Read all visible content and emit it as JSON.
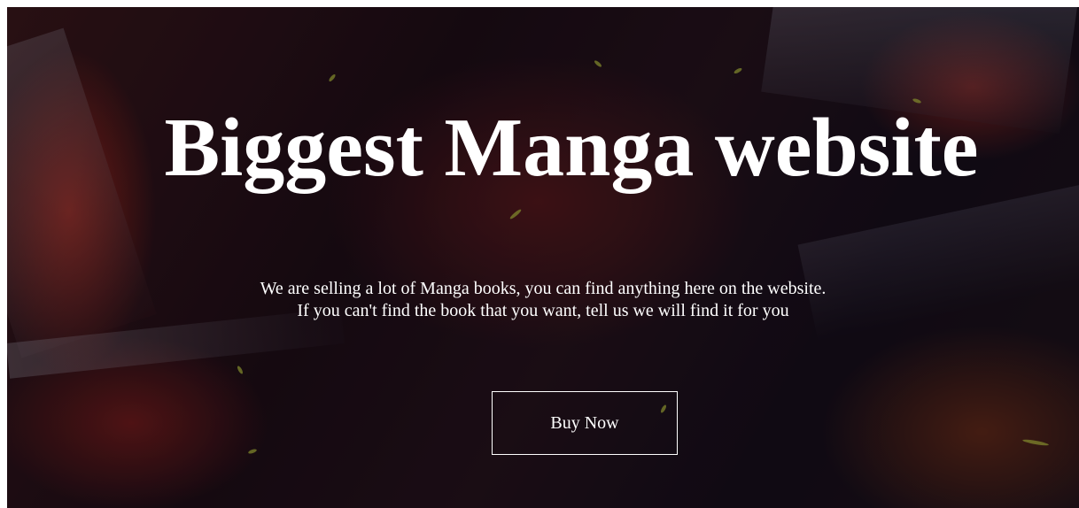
{
  "hero": {
    "headline": "Biggest Manga website",
    "description_line1": "We are selling a lot of Manga books, you can find anything here on the website.",
    "description_line2": "If you can't find the book that you want, tell us we will find it for you",
    "button_label": "Buy Now",
    "background_image": "manga-artwork-background"
  },
  "colors": {
    "text": "#ffffff",
    "button_border": "#ffffff",
    "background_dark": "#1c0a12",
    "background_red": "#be2819"
  }
}
